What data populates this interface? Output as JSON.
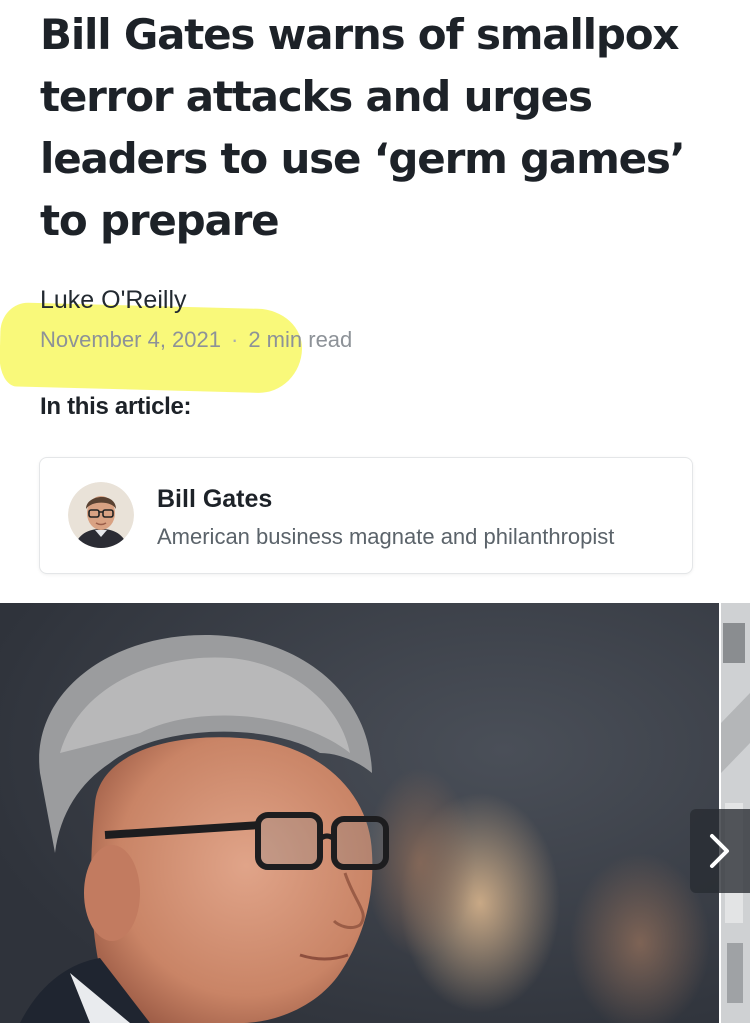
{
  "article": {
    "headline": "Bill Gates warns of smallpox terror attacks and urges leaders to use ‘germ games’ to prepare",
    "author": "Luke O'Reilly",
    "date": "November 4, 2021",
    "separator": "·",
    "read_time": "2 min read"
  },
  "related": {
    "heading": "In this article:",
    "entity": {
      "name": "Bill Gates",
      "description": "American business magnate and philanthropist"
    }
  },
  "colors": {
    "highlight": "#f7f746",
    "headline_text": "#1d2228",
    "meta_text": "#8d9298"
  },
  "icons": {
    "carousel_next": "chevron-right-icon"
  }
}
